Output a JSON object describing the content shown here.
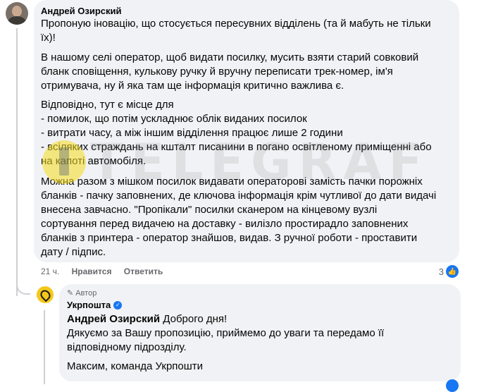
{
  "comment": {
    "author": "Андрей Озирский",
    "para1": [
      "Пропоную іновацію, що стосується пересувних відділень (та й мабуть не тільки",
      "їх)!"
    ],
    "para2": [
      "В нашому селі оператор, щоб видати посилку, мусить взяти старий совковий",
      "бланк сповіщення, кулькову ручку й вручну переписати трек-номер, ім'я",
      "отримувача, ну й яка там ще інформація критично важлива є."
    ],
    "para3": [
      "Відповідно, тут є місце для",
      "- помилок, що потім ускладнює облік виданих посилок",
      "- витрати часу, а між іншим відділення працює лише 2 години",
      "- всіляких страждань на кшталт писанини в погано освітленому приміщенні або",
      "на капоті автомобіля."
    ],
    "para4": [
      "Можна разом з мішком посилок видавати операторові замість пачки порожніх",
      "бланків - пачку заповнених, де ключова інформація крім чутливої до дати видачі",
      "внесена завчасно. \"Пропікали\" посилки сканером на кінцевому вузлі",
      "сортування перед видачею на доставку - вилізло простирадло заповнених",
      "бланків з принтера - оператор знайшов, видав. З ручної роботи - проставити",
      "дату / підпис."
    ],
    "time": "21 ч.",
    "like_label": "Нравится",
    "reply_label": "Ответить",
    "reaction_count": "3"
  },
  "reply": {
    "badge": "Автор",
    "author": "Укрпошта",
    "mention": "Андрей Озирский",
    "greeting": " Доброго дня!",
    "line2": [
      "Дякуємо за Вашу пропозицію, приймемо до уваги та передамо її",
      "відповідному підрозділу."
    ],
    "signature": "Максим, команда Укрпошти"
  },
  "watermark": "TELEGRAF",
  "colors": {
    "bubble": "#f0f2f5",
    "link_blue": "#1877f2",
    "secondary_text": "#65676b",
    "brand_yellow": "#f4c81a"
  },
  "icons": {
    "like": "thumbs-up-icon",
    "verified": "verified-check-icon",
    "author_badge": "pen-icon",
    "reply_avatar": "location-pin-icon"
  }
}
